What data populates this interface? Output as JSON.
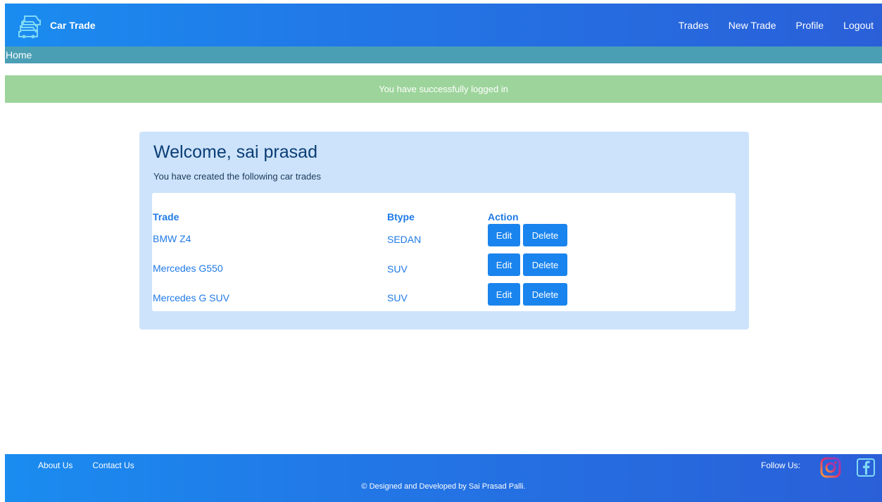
{
  "brand": {
    "name": "Car Trade",
    "logo_icon": "car-trade-logo-icon"
  },
  "nav": {
    "items": [
      {
        "label": "Trades"
      },
      {
        "label": "New Trade"
      },
      {
        "label": "Profile"
      },
      {
        "label": "Logout"
      }
    ]
  },
  "breadcrumb": {
    "label": "Home"
  },
  "flash": {
    "message": "You have successfully logged in",
    "color": "#9dd49b"
  },
  "main": {
    "welcome": "Welcome, sai prasad",
    "subtitle": "You have created the following car trades",
    "table": {
      "headers": {
        "trade": "Trade",
        "btype": "Btype",
        "action": "Action"
      },
      "rows": [
        {
          "trade": "BMW Z4",
          "btype": "SEDAN",
          "edit": "Edit",
          "delete": "Delete"
        },
        {
          "trade": "Mercedes G550",
          "btype": "SUV",
          "edit": "Edit",
          "delete": "Delete"
        },
        {
          "trade": "Mercedes G SUV",
          "btype": "SUV",
          "edit": "Edit",
          "delete": "Delete"
        }
      ]
    }
  },
  "footer": {
    "about": "About Us",
    "contact": "Contact Us",
    "follow": "Follow Us:",
    "copyright": "© Designed and Developed by Sai Prasad Palli.",
    "social": [
      "instagram-icon",
      "facebook-icon"
    ]
  },
  "colors": {
    "accent": "#1a84ee",
    "navbar": "#2277e6",
    "breadcrumb": "#4a9fb5",
    "card": "#cde3fb"
  }
}
